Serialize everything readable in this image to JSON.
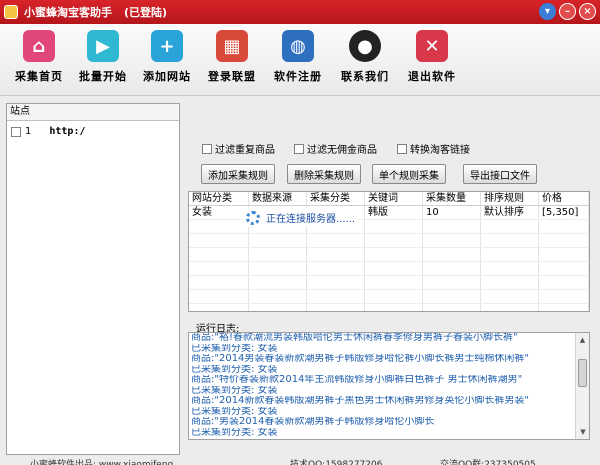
{
  "window": {
    "title": "小蜜蜂淘宝客助手",
    "status": "(已登陆)",
    "minimize": "–",
    "close": "×"
  },
  "toolbar": [
    {
      "label": "采集首页",
      "icon": "home-icon",
      "color": "#e0467c",
      "glyph": "⌂"
    },
    {
      "label": "批量开始",
      "icon": "play-icon",
      "color": "#2fb8d2",
      "glyph": "▶"
    },
    {
      "label": "添加网站",
      "icon": "plus-icon",
      "color": "#2aa4d8",
      "glyph": "+"
    },
    {
      "label": "登录联盟",
      "icon": "brick-wall-icon",
      "color": "#d94a3b",
      "glyph": "▦"
    },
    {
      "label": "软件注册",
      "icon": "globe-icon",
      "color": "#2e6fbf",
      "glyph": "◍"
    },
    {
      "label": "联系我们",
      "icon": "qq-penguin-icon",
      "color": "#222222",
      "glyph": "●"
    },
    {
      "label": "退出软件",
      "icon": "close-x-icon",
      "color": "#d8394a",
      "glyph": "✕"
    }
  ],
  "sites": {
    "header": "站点",
    "items": [
      {
        "index": "1",
        "url": "http:/"
      }
    ]
  },
  "options": [
    {
      "label": "过滤重复商品",
      "checked": false
    },
    {
      "label": "过滤无佣金商品",
      "checked": false
    },
    {
      "label": "转换淘客链接",
      "checked": false
    }
  ],
  "buttons": {
    "add_rule": "添加采集规则",
    "delete_rule": "删除采集规则",
    "single_rule": "单个规则采集",
    "export": "导出接口文件"
  },
  "grid": {
    "columns": [
      "网站分类",
      "数据来源",
      "采集分类",
      "关键词",
      "采集数量",
      "排序规则",
      "价格"
    ],
    "rows": [
      [
        "女装",
        "",
        "",
        "韩版",
        "10",
        "默认排序",
        "[5,350]"
      ]
    ]
  },
  "loading": "正在连接服务器......",
  "log": {
    "title": "运行日志:",
    "lines": [
      "商品:\"裕!春款潮流男装韩版哈伦男士休闲裤春季修身男裤子春装小脚长裤\"",
      "已采集到分类: 女装",
      "商品:\"2014男装春装新款潮男裤子韩版修身哈伦裤小脚长裤男士纯棉休闲裤\"",
      "已采集到分类: 女装",
      "商品:\"特价春装新款2014年主流韩版修身小脚裤白色裤子 男士休闲裤潮男\"",
      "已采集到分类: 女装",
      "商品:\"2014新款春装韩版潮男裤子黑色男士休闲裤男修身英伦小脚长裤男装\"",
      "已采集到分类: 女装",
      "商品:\"男装2014春装新款潮男裤子韩版修身哈伦小脚长",
      "已采集到分类: 女装"
    ]
  },
  "status": {
    "company": "小蜜蜂软件出品: www.xiaomifeng...",
    "qq": "技术QQ:1598277206",
    "group": "交流QQ群:237350505"
  }
}
